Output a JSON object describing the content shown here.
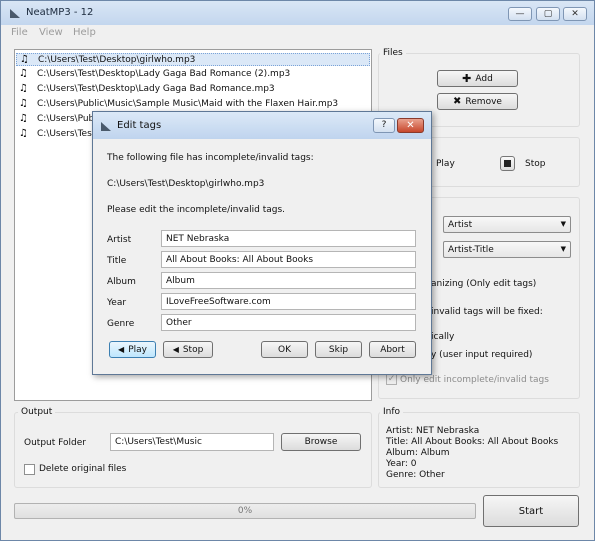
{
  "app": {
    "title": "NeatMP3 - 12"
  },
  "window_controls": {
    "minimize": "—",
    "maximize": "▢",
    "close": "✕"
  },
  "menu": [
    "File",
    "View",
    "Help"
  ],
  "files": [
    "C:\\Users\\Test\\Desktop\\girlwho.mp3",
    "C:\\Users\\Test\\Desktop\\Lady Gaga Bad Romance (2).mp3",
    "C:\\Users\\Test\\Desktop\\Lady Gaga Bad Romance.mp3",
    "C:\\Users\\Public\\Music\\Sample Music\\Maid with the Flaxen Hair.mp3",
    "C:\\Users\\Pub",
    "C:\\Users\\Tes"
  ],
  "files_group": {
    "title": "Files",
    "add_label": "Add",
    "remove_label": "Remove"
  },
  "player": {
    "play_label": "Play",
    "stop_label": "Stop"
  },
  "options": {
    "combo1": "Artist",
    "combo2": "Artist-Title",
    "text_organizing": "anizing (Only edit tags)",
    "text_invalid": "invalid tags will be fixed:",
    "text_auto": "ically",
    "text_user": "y (user input required)",
    "only_edit_label": "Only edit incomplete/invalid tags"
  },
  "output": {
    "title": "Output",
    "folder_label": "Output Folder",
    "folder_value": "C:\\Users\\Test\\Music",
    "browse_label": "Browse",
    "delete_label": "Delete original files"
  },
  "info": {
    "title": "Info",
    "artist": "Artist: NET Nebraska",
    "song_title": "Title: All About Books: All About Books",
    "album": "Album: Album",
    "year": "Year: 0",
    "genre": "Genre: Other"
  },
  "progress": {
    "text": "0%",
    "fraction": 0
  },
  "start_label": "Start",
  "dialog": {
    "title": "Edit tags",
    "help": "?",
    "close": "✕",
    "message": "The following file has incomplete/invalid tags:",
    "path": "C:\\Users\\Test\\Desktop\\girlwho.mp3",
    "instruction": "Please edit the incomplete/invalid tags.",
    "fields": {
      "artist_label": "Artist",
      "artist_value": "NET Nebraska",
      "title_label": "Title",
      "title_value": "All About Books: All About Books",
      "album_label": "Album",
      "album_value": "Album",
      "year_label": "Year",
      "year_value": "ILoveFreeSoftware.com",
      "genre_label": "Genre",
      "genre_value": "Other"
    },
    "play_label": "Play",
    "stop_label": "Stop",
    "ok_label": "OK",
    "skip_label": "Skip",
    "abort_label": "Abort"
  }
}
